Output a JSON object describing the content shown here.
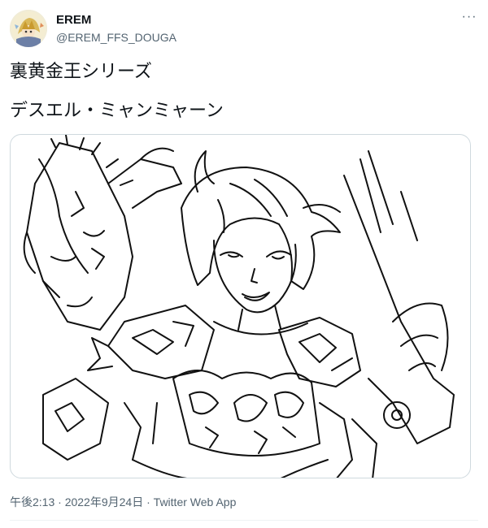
{
  "author": {
    "display_name": "EREM",
    "handle": "@EREM_FFS_DOUGA"
  },
  "tweet": {
    "line1": "裏黄金王シリーズ",
    "line2": "デスエル・ミャンミャーン"
  },
  "meta": {
    "time": "午後2:13",
    "separator1": " · ",
    "date": "2022年9月24日",
    "separator2": " · ",
    "source": "Twitter Web App"
  },
  "icons": {
    "more": "more-options-icon",
    "avatar": "avatar-image"
  },
  "colors": {
    "text_primary": "#0f1419",
    "text_secondary": "#536471",
    "border": "#cfd9de"
  }
}
